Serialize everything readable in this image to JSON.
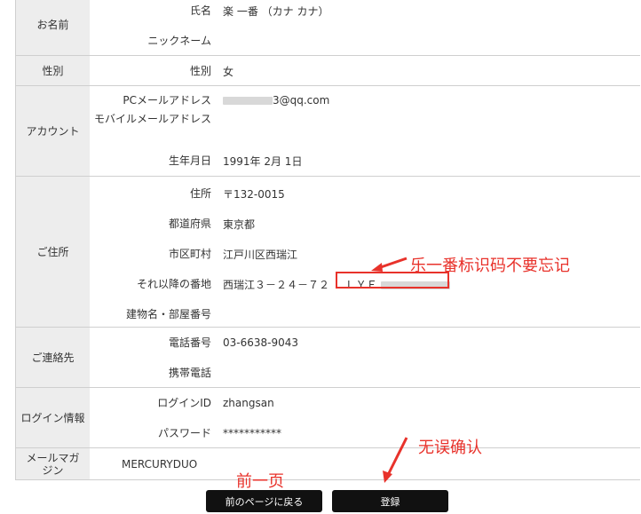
{
  "sections": [
    {
      "label": "お名前",
      "rows": [
        {
          "label": "氏名",
          "value": "楽 一番 （カナ カナ）"
        },
        {
          "label": "ニックネーム",
          "value": ""
        }
      ]
    },
    {
      "label": "性別",
      "rows": [
        {
          "label": "性別",
          "value": "女"
        }
      ]
    },
    {
      "label": "アカウント",
      "rows": [
        {
          "label": "PCメールアドレス",
          "value_suffix": "3@qq.com"
        },
        {
          "label": "モバイルメールアドレス",
          "value": ""
        },
        {
          "label": "生年月日",
          "value": "1991年 2月 1日"
        }
      ]
    },
    {
      "label": "ご住所",
      "rows": [
        {
          "label": "住所",
          "value": "〒132-0015"
        },
        {
          "label": "都道府県",
          "value": "東京都"
        },
        {
          "label": "市区町村",
          "value": "江戸川区西瑞江"
        },
        {
          "label": "それ以降の番地",
          "value": "西瑞江３－２４－７２",
          "code_prefix": "ＬＹＦ"
        },
        {
          "label": "建物名・部屋番号",
          "value": ""
        }
      ]
    },
    {
      "label": "ご連絡先",
      "rows": [
        {
          "label": "電話番号",
          "value": "03-6638-9043"
        },
        {
          "label": "携帯電話",
          "value": ""
        }
      ]
    },
    {
      "label": "ログイン情報",
      "rows": [
        {
          "label": "ログインID",
          "value": "zhangsan"
        },
        {
          "label": "パスワード",
          "value": "***********"
        }
      ]
    },
    {
      "label": "メールマガジン",
      "value": "MERCURYDUO"
    }
  ],
  "annotations": {
    "code_note": "乐一番标识码不要忘记",
    "confirm_note": "无误确认",
    "prev_note": "前一页"
  },
  "buttons": {
    "back": "前のページに戻る",
    "register": "登録"
  },
  "colors": {
    "annotation": "#e8322b",
    "button_bg": "#111111",
    "label_bg": "#ededed"
  }
}
